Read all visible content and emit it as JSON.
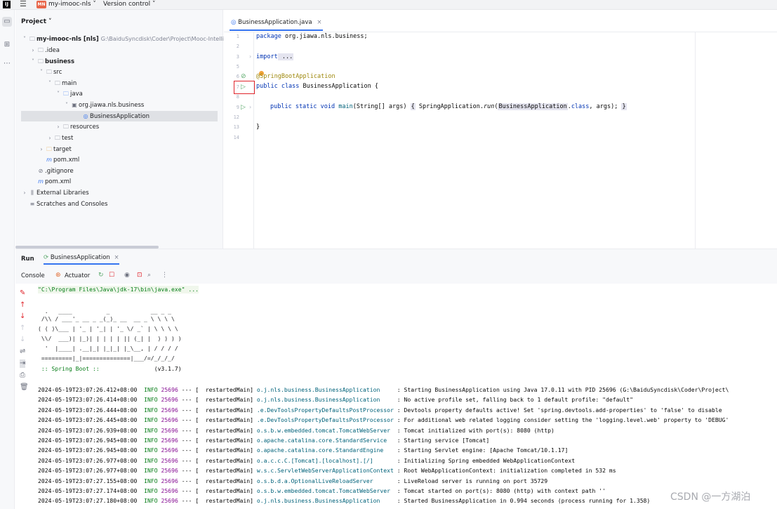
{
  "titlebar": {
    "project_badge": "MN",
    "project_name": "my-imooc-nls ˅",
    "version_control": "Version control ˅"
  },
  "project_pane": {
    "header": "Project ˅",
    "root_label": "my-imooc-nls [nls]",
    "root_path": "G:\\BaiduSyncdisk\\Coder\\Project\\Mooc-Intelli",
    "items": [
      {
        "label": ".idea"
      },
      {
        "label": "business"
      },
      {
        "label": "src"
      },
      {
        "label": "main"
      },
      {
        "label": "java"
      },
      {
        "label": "org.jiawa.nls.business"
      },
      {
        "label": "BusinessApplication"
      },
      {
        "label": "resources"
      },
      {
        "label": "test"
      },
      {
        "label": "target"
      },
      {
        "label": "pom.xml"
      },
      {
        "label": ".gitignore"
      },
      {
        "label": "pom.xml"
      },
      {
        "label": "External Libraries"
      },
      {
        "label": "Scratches and Consoles"
      }
    ]
  },
  "editor": {
    "tab_label": "BusinessApplication.java",
    "line_numbers": [
      "1",
      "2",
      "3",
      "5",
      "6",
      "7",
      "8",
      "9",
      "12",
      "13",
      "14"
    ],
    "code": {
      "package_kw": "package",
      "package_name": " org.jiawa.nls.business;",
      "import_kw": "import",
      "import_fold": " ...",
      "annotation": "@SpringBootApplication",
      "class_decl_kw": "public class",
      "class_name": " BusinessApplication {",
      "main_kw": "public static void",
      "main_name": " main",
      "main_rest": "(String[] args) ",
      "main_body_open": "{",
      "main_body_mid": " SpringApplication.",
      "run_name": "run",
      "run_args_a": "(",
      "run_args_b": "BusinessApplication",
      "run_args_c": ".",
      "class_kw": "class",
      "run_args_d": ", args); ",
      "main_body_close": "}",
      "closing": "}"
    }
  },
  "run_panel": {
    "title": "Run",
    "tab_label": "BusinessApplication",
    "tools": {
      "console": "Console",
      "actuator": "Actuator"
    },
    "command": "\"C:\\Program Files\\Java\\jdk-17\\bin\\java.exe\" ...",
    "banner": [
      "  .   ____          _            __ _ _",
      " /\\\\ / ___'_ __ _ _(_)_ __  __ _ \\ \\ \\ \\",
      "( ( )\\___ | '_ | '_| | '_ \\/ _` | \\ \\ \\ \\",
      " \\\\/  ___)| |_)| | | | | || (_| |  ) ) ) )",
      "  '  |____| .__|_| |_|_| |_\\__, | / / / /",
      " =========|_|==============|___/=/_/_/_/"
    ],
    "spring_boot": " :: Spring Boot ::",
    "spring_version": "(v3.1.7)",
    "logs": [
      {
        "ts": "2024-05-19T23:07:26.412+08:00",
        "level": "INFO",
        "pid": "25696",
        "thread": "--- [  restartedMain]",
        "logger": "o.j.nls.business.BusinessApplication    ",
        "msg": " : Starting BusinessApplication using Java 17.0.11 with PID 25696 (G:\\BaiduSyncdisk\\Coder\\Project\\"
      },
      {
        "ts": "2024-05-19T23:07:26.414+08:00",
        "level": "INFO",
        "pid": "25696",
        "thread": "--- [  restartedMain]",
        "logger": "o.j.nls.business.BusinessApplication    ",
        "msg": " : No active profile set, falling back to 1 default profile: \"default\""
      },
      {
        "ts": "2024-05-19T23:07:26.444+08:00",
        "level": "INFO",
        "pid": "25696",
        "thread": "--- [  restartedMain]",
        "logger": ".e.DevToolsPropertyDefaultsPostProcessor",
        "msg": " : Devtools property defaults active! Set 'spring.devtools.add-properties' to 'false' to disable"
      },
      {
        "ts": "2024-05-19T23:07:26.445+08:00",
        "level": "INFO",
        "pid": "25696",
        "thread": "--- [  restartedMain]",
        "logger": ".e.DevToolsPropertyDefaultsPostProcessor",
        "msg": " : For additional web related logging consider setting the 'logging.level.web' property to 'DEBUG'"
      },
      {
        "ts": "2024-05-19T23:07:26.939+08:00",
        "level": "INFO",
        "pid": "25696",
        "thread": "--- [  restartedMain]",
        "logger": "o.s.b.w.embedded.tomcat.TomcatWebServer ",
        "msg": " : Tomcat initialized with port(s): 8080 (http)"
      },
      {
        "ts": "2024-05-19T23:07:26.945+08:00",
        "level": "INFO",
        "pid": "25696",
        "thread": "--- [  restartedMain]",
        "logger": "o.apache.catalina.core.StandardService  ",
        "msg": " : Starting service [Tomcat]"
      },
      {
        "ts": "2024-05-19T23:07:26.945+08:00",
        "level": "INFO",
        "pid": "25696",
        "thread": "--- [  restartedMain]",
        "logger": "o.apache.catalina.core.StandardEngine   ",
        "msg": " : Starting Servlet engine: [Apache Tomcat/10.1.17]"
      },
      {
        "ts": "2024-05-19T23:07:26.977+08:00",
        "level": "INFO",
        "pid": "25696",
        "thread": "--- [  restartedMain]",
        "logger": "o.a.c.c.C.[Tomcat].[localhost].[/]      ",
        "msg": " : Initializing Spring embedded WebApplicationContext"
      },
      {
        "ts": "2024-05-19T23:07:26.977+08:00",
        "level": "INFO",
        "pid": "25696",
        "thread": "--- [  restartedMain]",
        "logger": "w.s.c.ServletWebServerApplicationContext",
        "msg": " : Root WebApplicationContext: initialization completed in 532 ms"
      },
      {
        "ts": "2024-05-19T23:07:27.155+08:00",
        "level": "INFO",
        "pid": "25696",
        "thread": "--- [  restartedMain]",
        "logger": "o.s.b.d.a.OptionalLiveReloadServer      ",
        "msg": " : LiveReload server is running on port 35729"
      },
      {
        "ts": "2024-05-19T23:07:27.174+08:00",
        "level": "INFO",
        "pid": "25696",
        "thread": "--- [  restartedMain]",
        "logger": "o.s.b.w.embedded.tomcat.TomcatWebServer ",
        "msg": " : Tomcat started on port(s): 8080 (http) with context path ''"
      },
      {
        "ts": "2024-05-19T23:07:27.180+08:00",
        "level": "INFO",
        "pid": "25696",
        "thread": "--- [  restartedMain]",
        "logger": "o.j.nls.business.BusinessApplication    ",
        "msg": " : Started BusinessApplication in 0.994 seconds (process running for 1.358)"
      }
    ]
  },
  "watermark": "CSDN @一方湖泊",
  "colors": {
    "accent": "#3574f0",
    "highlight_box": "#e0242b",
    "run_green": "#59a869"
  }
}
